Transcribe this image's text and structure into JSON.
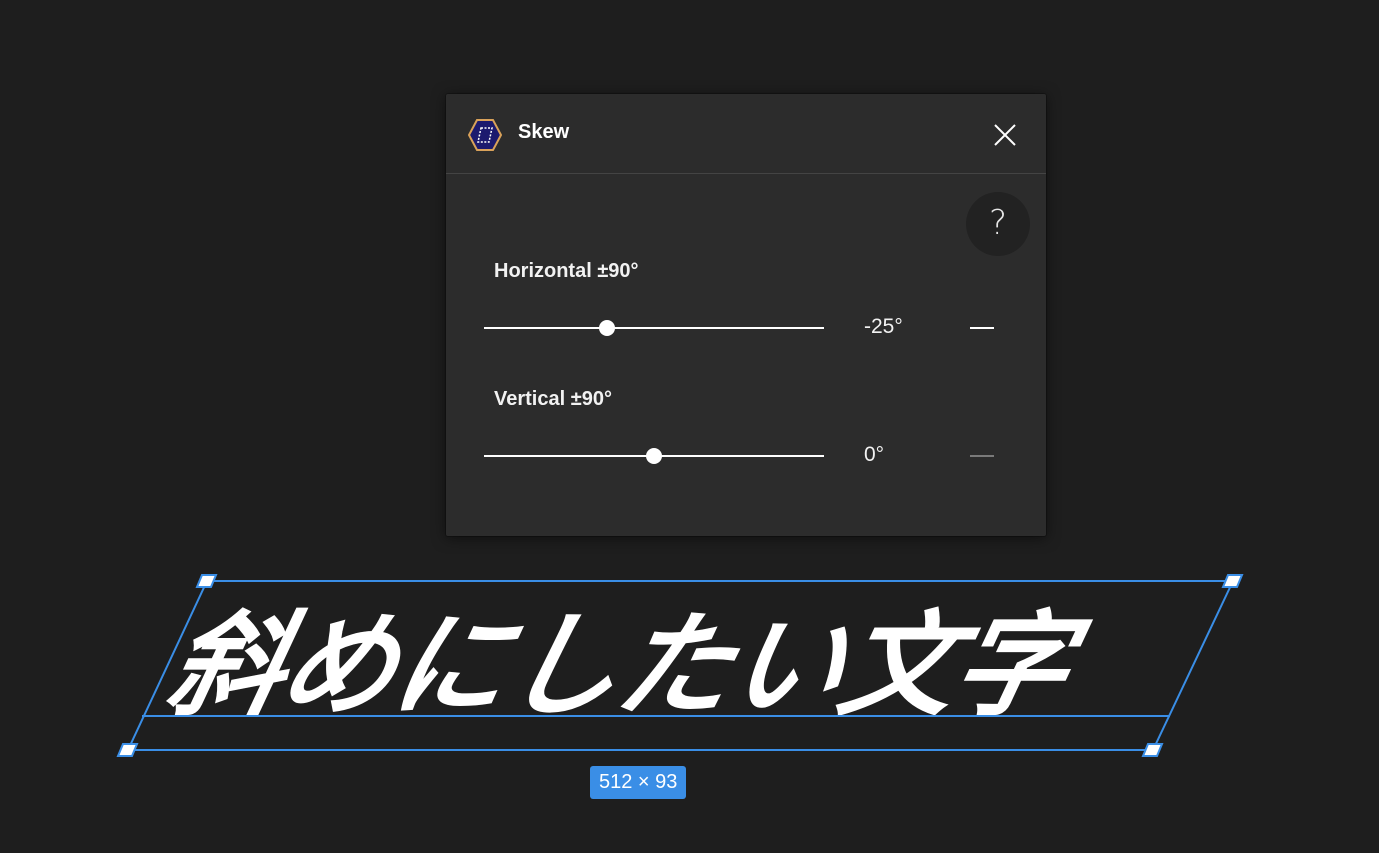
{
  "panel": {
    "title": "Skew",
    "plugin_icon": "skew-plugin-icon",
    "close_icon": "close-icon",
    "help_label": "?",
    "horizontal": {
      "label": "Horizontal ±90°",
      "value_text": "-25°",
      "value": -25,
      "min": -90,
      "max": 90,
      "reset_enabled": true
    },
    "vertical": {
      "label": "Vertical ±90°",
      "value_text": "0°",
      "value": 0,
      "min": -90,
      "max": 90,
      "reset_enabled": false
    }
  },
  "canvas": {
    "text_content": "斜めにしたい文字",
    "size_badge": "512 × 93"
  },
  "colors": {
    "background": "#1e1e1e",
    "panel": "#2c2c2c",
    "selection": "#3a8ee6",
    "text": "#ffffff",
    "reset_active": "#ffffff",
    "reset_disabled": "#7a7a7a"
  }
}
